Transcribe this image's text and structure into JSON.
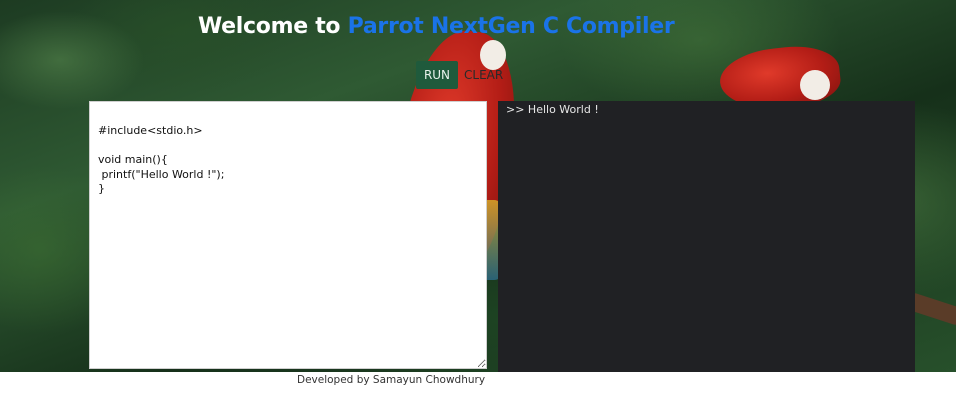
{
  "header": {
    "title_prefix": "Welcome to",
    "title_brand": "Parrot NextGen C Compiler"
  },
  "toolbar": {
    "run_label": "RUN",
    "clear_label": "CLEAR"
  },
  "editor": {
    "code": "#include<stdio.h>\n\nvoid main(){\n printf(\"Hello World !\");\n}"
  },
  "output": {
    "text": ">> Hello World !"
  },
  "footer": {
    "credit": "Developed by Samayun Chowdhury"
  },
  "colors": {
    "brand": "#1a73e8",
    "run_button": "#1f5a3c",
    "output_bg": "#202124"
  }
}
